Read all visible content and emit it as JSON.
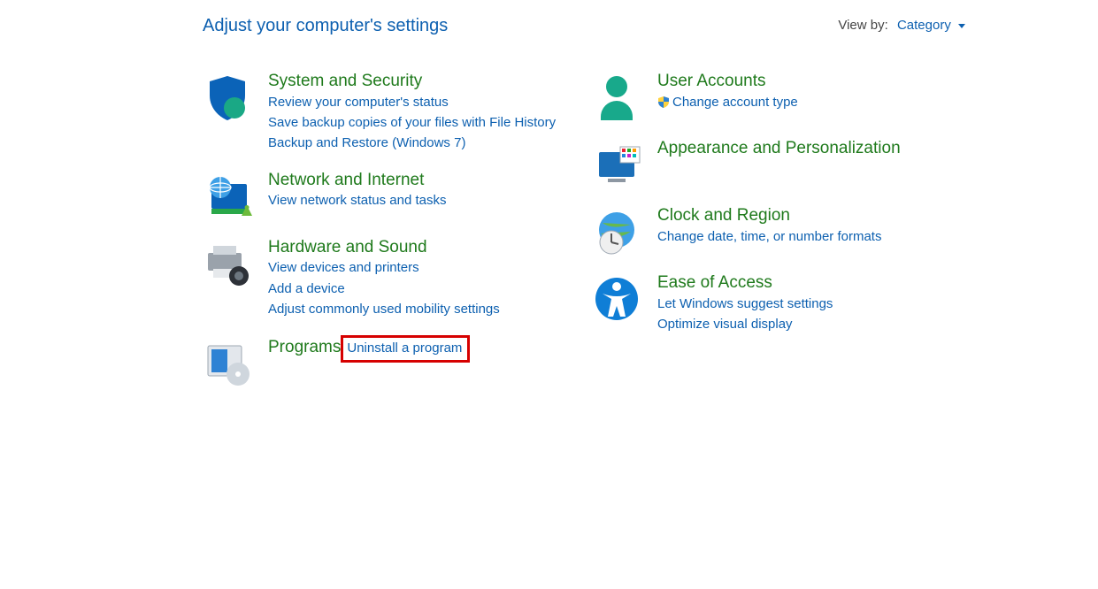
{
  "heading": "Adjust your computer's settings",
  "viewby": {
    "label": "View by:",
    "value": "Category"
  },
  "left": [
    {
      "id": "system-security",
      "icon": "shield-icon",
      "title": "System and Security",
      "links": [
        {
          "id": "review-status",
          "text": "Review your computer's status"
        },
        {
          "id": "file-history",
          "text": "Save backup copies of your files with File History"
        },
        {
          "id": "backup-restore",
          "text": "Backup and Restore (Windows 7)"
        }
      ]
    },
    {
      "id": "network-internet",
      "icon": "globe-monitor-icon",
      "title": "Network and Internet",
      "links": [
        {
          "id": "network-status",
          "text": "View network status and tasks"
        }
      ]
    },
    {
      "id": "hardware-sound",
      "icon": "printer-camera-icon",
      "title": "Hardware and Sound",
      "links": [
        {
          "id": "devices-printers",
          "text": "View devices and printers"
        },
        {
          "id": "add-device",
          "text": "Add a device"
        },
        {
          "id": "mobility",
          "text": "Adjust commonly used mobility settings"
        }
      ]
    },
    {
      "id": "programs",
      "icon": "programs-disc-icon",
      "title": "Programs",
      "links": [
        {
          "id": "uninstall",
          "text": "Uninstall a program",
          "highlight": true
        }
      ]
    }
  ],
  "right": [
    {
      "id": "user-accounts",
      "icon": "user-icon",
      "title": "User Accounts",
      "links": [
        {
          "id": "change-account-type",
          "text": "Change account type",
          "shield": true
        }
      ]
    },
    {
      "id": "appearance",
      "icon": "monitor-tiles-icon",
      "title": "Appearance and Personalization",
      "links": []
    },
    {
      "id": "clock-region",
      "icon": "globe-clock-icon",
      "title": "Clock and Region",
      "links": [
        {
          "id": "change-date-time",
          "text": "Change date, time, or number formats"
        }
      ]
    },
    {
      "id": "ease-of-access",
      "icon": "accessibility-icon",
      "title": "Ease of Access",
      "links": [
        {
          "id": "suggest-settings",
          "text": "Let Windows suggest settings"
        },
        {
          "id": "optimize-visual",
          "text": "Optimize visual display"
        }
      ]
    }
  ]
}
